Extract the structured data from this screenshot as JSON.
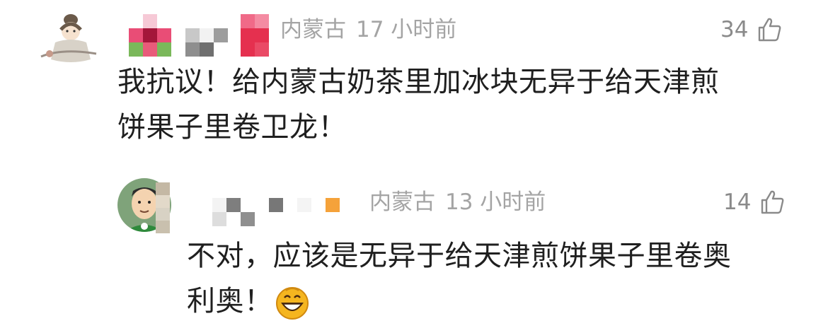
{
  "comments": [
    {
      "location": "内蒙古",
      "time": "17 小时前",
      "likes": "34",
      "lines": [
        "我抗议！给内蒙古奶茶里加冰块无异于给天津煎",
        "饼果子里卷卫龙！"
      ],
      "avatar_icon": "cartoon-girl-avatar",
      "username_state": "pixelated"
    },
    {
      "location": "内蒙古",
      "time": "13 小时前",
      "likes": "14",
      "lines": [
        "不对，应该是无异于给天津煎饼果子里卷奥",
        "利奥！"
      ],
      "emoji_icon": "grinning-face-emoji",
      "avatar_icon": "cartoon-boy-avatar",
      "username_state": "pixelated"
    }
  ],
  "colors": {
    "meta": "#a4a4a4",
    "likes": "#8a8a8a",
    "text": "#1f1f1f",
    "emoji": "#f5b51f"
  }
}
